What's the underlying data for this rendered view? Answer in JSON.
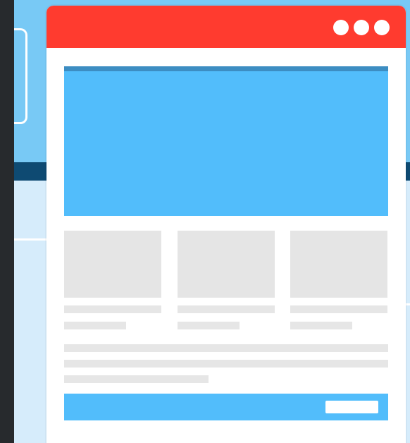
{
  "illustration": {
    "subject": "",
    "colors": {
      "background": "#6cc4f6",
      "accent": "#ff3b2f",
      "hero": "#52bdfb",
      "placeholder": "#e5e5e5"
    },
    "titlebar": {
      "window_controls": [
        {
          "icon": "circle-dot-icon"
        },
        {
          "icon": "circle-dot-icon"
        },
        {
          "icon": "circle-dot-icon"
        }
      ]
    },
    "content_cards": 3,
    "cta": {
      "label": ""
    }
  }
}
